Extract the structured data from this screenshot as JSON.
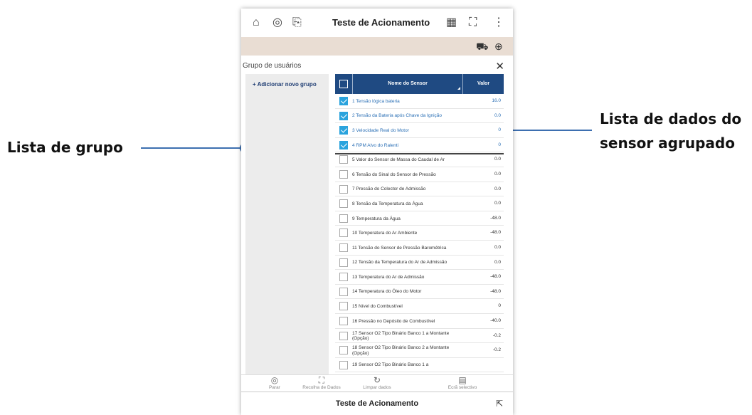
{
  "callouts": {
    "left": "Lista de grupo",
    "right_line1": "Lista de dados do",
    "right_line2": "sensor agrupado"
  },
  "topbar": {
    "title": "Teste de Acionamento",
    "icons": [
      "home-icon",
      "diagnostic-icon",
      "export-icon",
      "calendar-icon",
      "fit-screen-icon",
      "more-vertical-icon"
    ]
  },
  "toolbar2": {
    "icons": [
      "car-settings-icon",
      "arrow-circle-icon"
    ],
    "background": "#e9ddd3"
  },
  "group_panel": {
    "title": "Grupo de usuários",
    "add_label": "+ Adicionar novo grupo"
  },
  "table": {
    "col_name": "Nome do Sensor",
    "col_value": "Valor",
    "header_color": "#1f4a82",
    "rows": [
      {
        "name": "1 Tensão lógica bateria",
        "value": "16.0",
        "checked": true
      },
      {
        "name": "2 Tensão da Bateria após Chave da Ignição",
        "value": "0.0",
        "checked": true
      },
      {
        "name": "3 Velocidade Real do Motor",
        "value": "0",
        "checked": true
      },
      {
        "name": "4 RPM Alvo do Ralenti",
        "value": "0",
        "checked": true
      },
      {
        "name": "5 Valor do Sensor de Massa do Caudal de Ar",
        "value": "0.0",
        "checked": false
      },
      {
        "name": "6 Tensão do Sinal do Sensor de Pressão",
        "value": "0.0",
        "checked": false
      },
      {
        "name": "7 Pressão do Colector de Admissão",
        "value": "0.0",
        "checked": false
      },
      {
        "name": "8 Tensão da Temperatura da Água",
        "value": "0.0",
        "checked": false
      },
      {
        "name": "9 Temperatura da Água",
        "value": "-48.0",
        "checked": false
      },
      {
        "name": "10 Temperatura do Ar Ambiente",
        "value": "-48.0",
        "checked": false
      },
      {
        "name": "11 Tensão do Sensor de Pressão Barométrica",
        "value": "0.0",
        "checked": false
      },
      {
        "name": "12 Tensão da Temperatura do Ar de Admissão",
        "value": "0.0",
        "checked": false
      },
      {
        "name": "13 Temperatura do Ar de Admissão",
        "value": "-48.0",
        "checked": false
      },
      {
        "name": "14 Temperatura do Óleo do Motor",
        "value": "-48.0",
        "checked": false
      },
      {
        "name": "15 Nível do Combustível",
        "value": "0",
        "checked": false
      },
      {
        "name": "16 Pressão no Depósito de Combustível",
        "value": "-40.0",
        "checked": false
      },
      {
        "name": "17 Sensor O2 Tipo Binário Banco 1 a Montante (Opção)",
        "value": "-0.2",
        "checked": false
      },
      {
        "name": "18 Sensor O2 Tipo Binário Banco 2 a Montante (Opção)",
        "value": "-0.2",
        "checked": false
      },
      {
        "name": "19 Sensor O2 Tipo Binário Banco 1 a",
        "value": "",
        "checked": false
      }
    ]
  },
  "actions": [
    {
      "label": "Parar",
      "icon": "stop-icon"
    },
    {
      "label": "Recolha de Dados",
      "icon": "record-icon"
    },
    {
      "label": "Limpar dados",
      "icon": "refresh-icon"
    },
    {
      "label": "Ecrã selectivo",
      "icon": "select-screen-icon"
    }
  ],
  "footer": {
    "title": "Teste de Acionamento",
    "icon": "pin-icon"
  },
  "accent_color": "#3d6fb0"
}
